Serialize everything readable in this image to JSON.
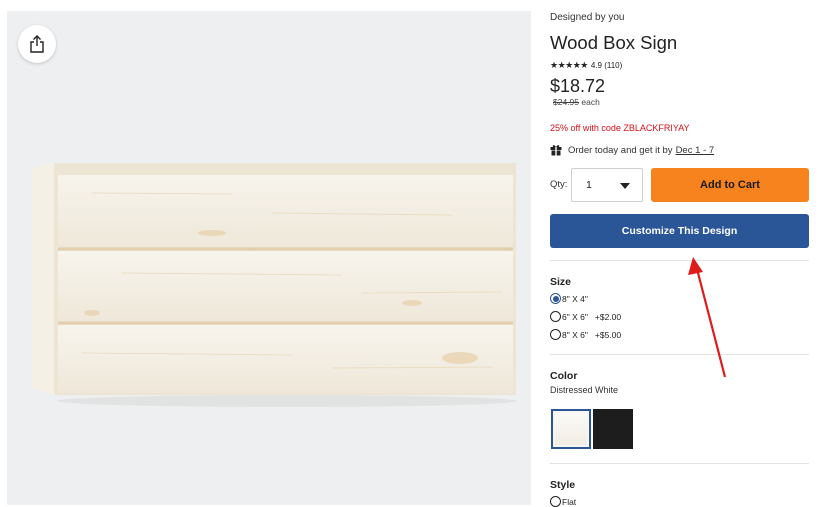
{
  "product": {
    "designer": "Designed by you",
    "title": "Wood Box Sign",
    "rating_value": "4.9",
    "rating_count": "(110)",
    "price": "$18.72",
    "original_price": "$24.95",
    "price_unit": "each",
    "promo": "25% off with code ZBLACKFRIYAY",
    "delivery_text": "Order today and get it by",
    "delivery_date": "Dec 1 - 7"
  },
  "purchase": {
    "qty_label": "Qty:",
    "qty_value": "1",
    "add_to_cart_label": "Add to Cart",
    "customize_label": "Customize This Design"
  },
  "size": {
    "title": "Size",
    "options": [
      {
        "label": "8\" X 4\"",
        "extra": "",
        "selected": true
      },
      {
        "label": "6\" X 6\"",
        "extra": "+$2.00",
        "selected": false
      },
      {
        "label": "8\" X 6\"",
        "extra": "+$5.00",
        "selected": false
      }
    ]
  },
  "color": {
    "title": "Color",
    "selected_name": "Distressed White",
    "swatches": [
      {
        "name": "Distressed White",
        "hex": "#f8f6f1",
        "selected": true
      },
      {
        "name": "Black",
        "hex": "#1d1d1d",
        "selected": false
      }
    ]
  },
  "style": {
    "title": "Style",
    "options": [
      {
        "label": "Flat",
        "selected": false
      }
    ]
  },
  "icons": {
    "share": "share-icon",
    "gift": "gift-icon",
    "star": "star-icon",
    "caret": "chevron-down-icon",
    "annotation": "red-arrow-annotation"
  },
  "colors": {
    "cta_orange": "#f7831e",
    "cta_blue": "#2a5597",
    "promo_red": "#d6111a",
    "annotation_red": "#e01b1b"
  }
}
